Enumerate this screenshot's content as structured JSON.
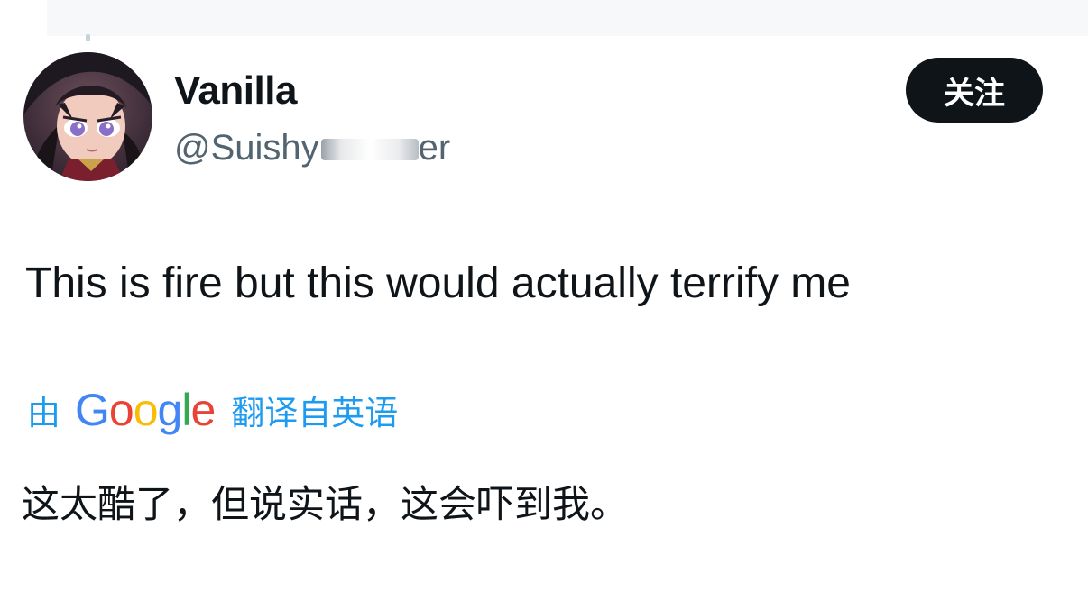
{
  "tweet": {
    "author": {
      "display_name": "Vanilla",
      "handle_visible_start": "@Suishy",
      "handle_visible_end": "er",
      "avatar_icon": "anime-character-avatar"
    },
    "follow_button_label": "关注",
    "text": "This is fire but this would actually terrify me",
    "translation": {
      "by_label": "由",
      "provider_letters": [
        "G",
        "o",
        "o",
        "g",
        "l",
        "e"
      ],
      "provider_colors": [
        "#4285F4",
        "#EA4335",
        "#FBBC05",
        "#4285F4",
        "#34A853",
        "#EA4335"
      ],
      "from_label": "翻译自英语",
      "text": "这太酷了，但说实话，这会吓到我。"
    }
  },
  "colors": {
    "text_primary": "#0f1419",
    "text_secondary": "#536471",
    "link_blue": "#1d9bf0",
    "button_bg": "#0f1419",
    "button_text": "#ffffff"
  }
}
